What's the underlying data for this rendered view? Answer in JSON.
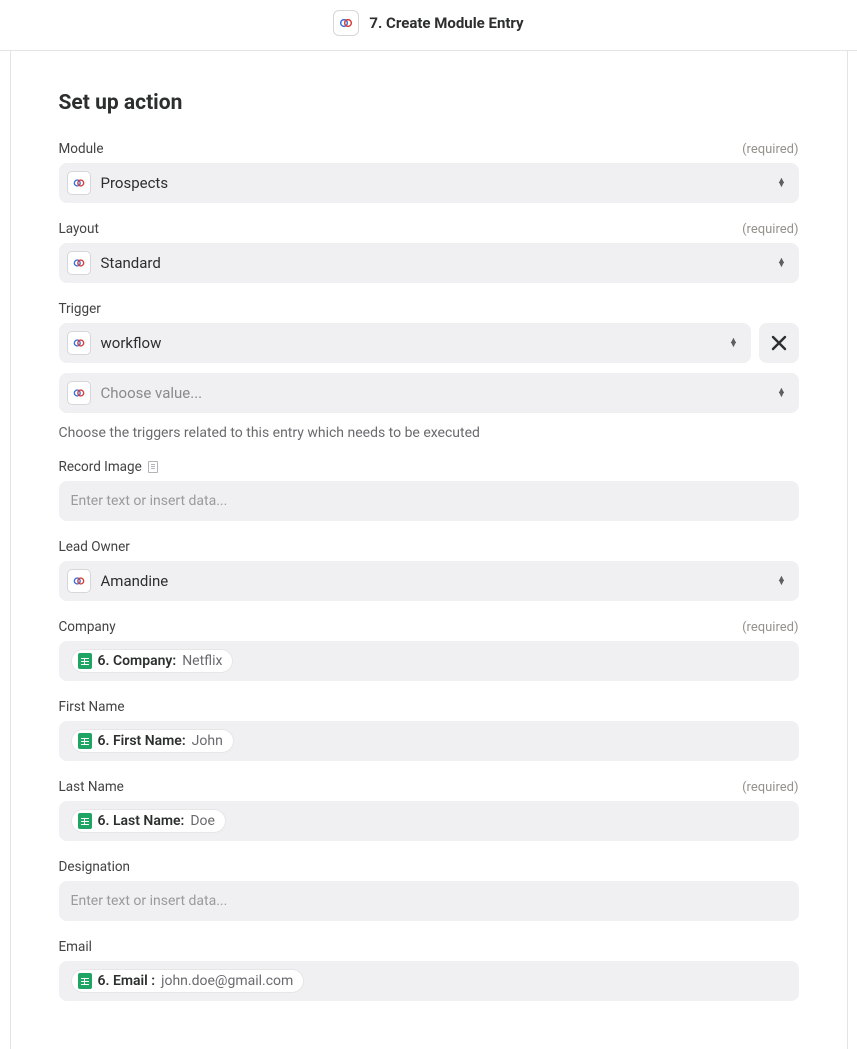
{
  "header": {
    "title": "7. Create Module Entry"
  },
  "section_title": "Set up action",
  "required_label": "(required)",
  "fields": {
    "module": {
      "label": "Module",
      "value": "Prospects",
      "required": true
    },
    "layout": {
      "label": "Layout",
      "value": "Standard",
      "required": true
    },
    "trigger": {
      "label": "Trigger",
      "value": "workflow",
      "placeholder": "Choose value...",
      "helper": "Choose the triggers related to this entry which needs to be executed"
    },
    "record_image": {
      "label": "Record Image",
      "placeholder": "Enter text or insert data..."
    },
    "lead_owner": {
      "label": "Lead Owner",
      "value": "Amandine"
    },
    "company": {
      "label": "Company",
      "required": true,
      "pill_label": "6. Company:",
      "pill_value": "Netflix"
    },
    "first_name": {
      "label": "First Name",
      "pill_label": "6. First Name:",
      "pill_value": "John"
    },
    "last_name": {
      "label": "Last Name",
      "required": true,
      "pill_label": "6. Last Name:",
      "pill_value": "Doe"
    },
    "designation": {
      "label": "Designation",
      "placeholder": "Enter text or insert data..."
    },
    "email": {
      "label": "Email",
      "pill_label": "6. Email :",
      "pill_value": "john.doe@gmail.com"
    }
  }
}
